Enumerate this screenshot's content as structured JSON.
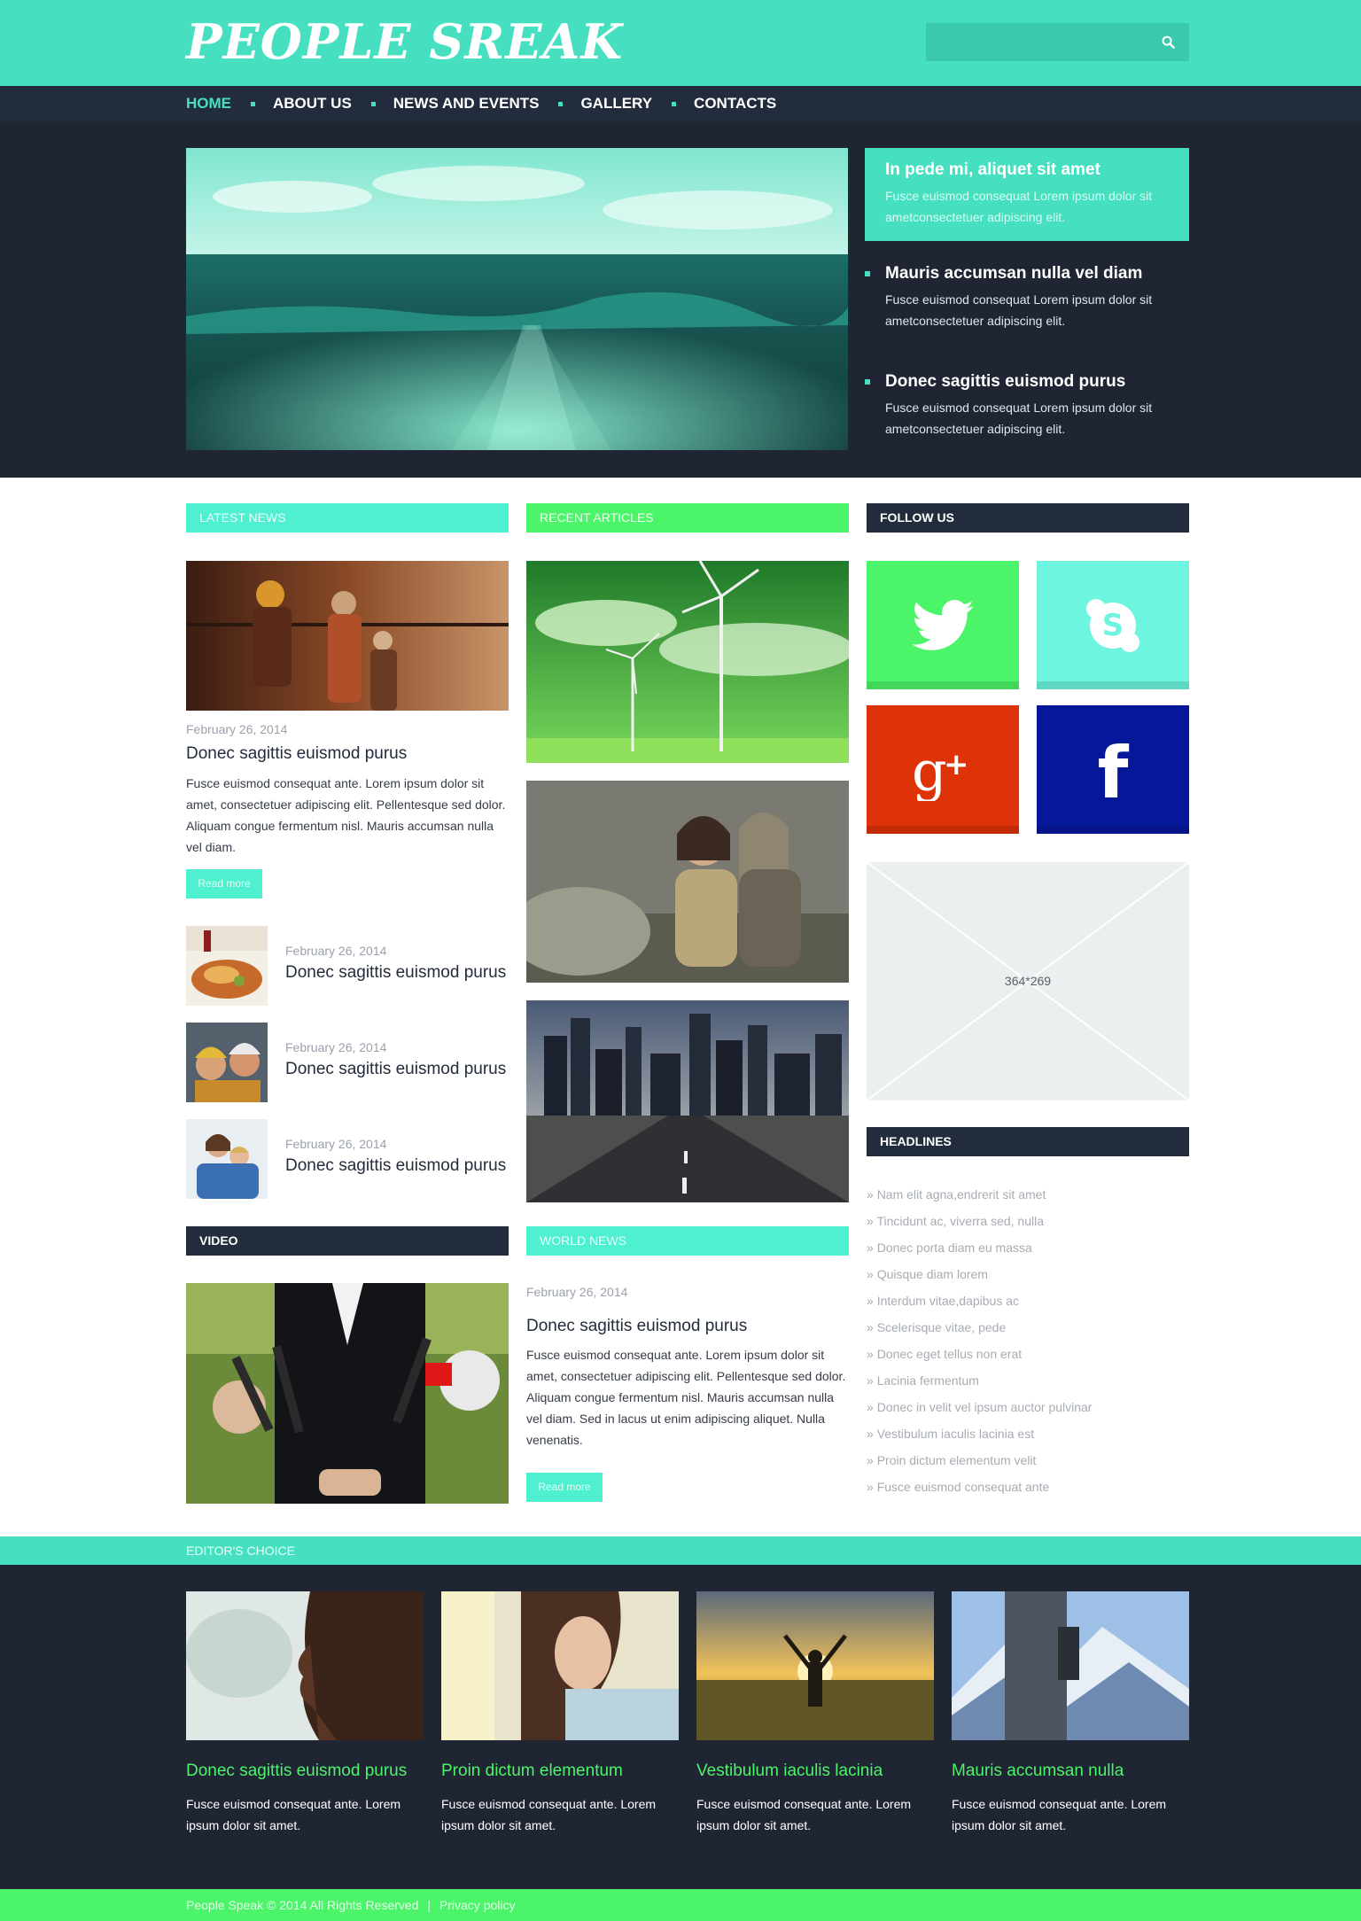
{
  "header": {
    "logo": "PEOPLE SREAK",
    "search_placeholder": ""
  },
  "nav": {
    "items": [
      "HOME",
      "ABOUT US",
      "NEWS AND EVENTS",
      "GALLERY",
      "CONTACTS"
    ],
    "active": "HOME"
  },
  "hero": {
    "side_items": [
      {
        "title": "In pede mi, aliquet sit amet",
        "text": "Fusce euismod consequat Lorem ipsum dolor sit ametconsectetuer adipiscing elit."
      },
      {
        "title": "Mauris accumsan nulla vel diam",
        "text": "Fusce euismod consequat Lorem ipsum dolor sit ametconsectetuer adipiscing elit."
      },
      {
        "title": "Donec sagittis euismod purus",
        "text": "Fusce euismod consequat Lorem ipsum dolor sit ametconsectetuer adipiscing elit."
      }
    ]
  },
  "sections": {
    "latest_news": "LATEST NEWS",
    "recent_articles": "RECENT ARTICLES",
    "follow_us": "FOLLOW US",
    "headlines": "HEADLINES",
    "video": "VIDEO",
    "world_news": "WORLD NEWS",
    "editors_choice": "EDITOR'S CHOICE"
  },
  "latest_news": {
    "feature": {
      "date": "February 26, 2014",
      "title": "Donec sagittis euismod purus",
      "text": "Fusce euismod consequat ante. Lorem ipsum dolor sit amet, consectetuer adipiscing elit. Pellentesque sed dolor. Aliquam congue fermentum nisl. Mauris accumsan nulla vel diam.",
      "read_more": "Read more"
    },
    "items": [
      {
        "date": "February 26, 2014",
        "title": "Donec sagittis euismod purus"
      },
      {
        "date": "February 26, 2014",
        "title": "Donec sagittis euismod purus"
      },
      {
        "date": "February 26, 2014",
        "title": "Donec sagittis euismod purus"
      }
    ]
  },
  "world_news": {
    "date": "February 26, 2014",
    "title": "Donec sagittis euismod purus",
    "text": "Fusce euismod consequat ante. Lorem ipsum dolor sit amet, consectetuer adipiscing elit. Pellentesque sed dolor. Aliquam congue fermentum nisl. Mauris accumsan nulla vel diam. Sed in lacus ut enim adipiscing aliquet. Nulla venenatis.",
    "read_more": "Read more"
  },
  "social": {
    "twitter": {
      "icon": "twitter-icon",
      "color": "#4cf46a"
    },
    "skype": {
      "icon": "skype-icon",
      "color": "#6df5df"
    },
    "googleplus": {
      "icon": "google-plus-icon",
      "color": "#de3209"
    },
    "facebook": {
      "icon": "facebook-icon",
      "color": "#06189a"
    }
  },
  "placeholder_label": "364*269",
  "headlines": [
    "Nam elit agna,endrerit sit amet",
    "Tincidunt ac, viverra sed, nulla",
    "Donec porta diam eu massa",
    "Quisque diam lorem",
    "Interdum vitae,dapibus ac",
    "Scelerisque vitae, pede",
    "Donec eget tellus non erat",
    "Lacinia fermentum",
    "Donec in velit vel ipsum auctor pulvinar",
    "Vestibulum iaculis lacinia est",
    "Proin dictum elementum velit",
    "Fusce euismod consequat ante"
  ],
  "editors_choice": [
    {
      "title": "Donec sagittis euismod purus",
      "text": "Fusce euismod consequat ante. Lorem ipsum dolor sit amet."
    },
    {
      "title": "Proin dictum elementum",
      "text": "Fusce euismod consequat ante. Lorem ipsum dolor sit amet."
    },
    {
      "title": "Vestibulum iaculis lacinia",
      "text": "Fusce euismod consequat ante. Lorem ipsum dolor sit amet."
    },
    {
      "title": "Mauris accumsan nulla",
      "text": "Fusce euismod consequat ante. Lorem ipsum dolor sit amet."
    }
  ],
  "footer": {
    "copyright": "People Speak © 2014 All Rights Reserved",
    "separator": "|",
    "privacy": "Privacy policy"
  },
  "colors": {
    "accent_teal": "#46e0c0",
    "accent_green": "#4cf46a",
    "dark": "#1f2533"
  }
}
